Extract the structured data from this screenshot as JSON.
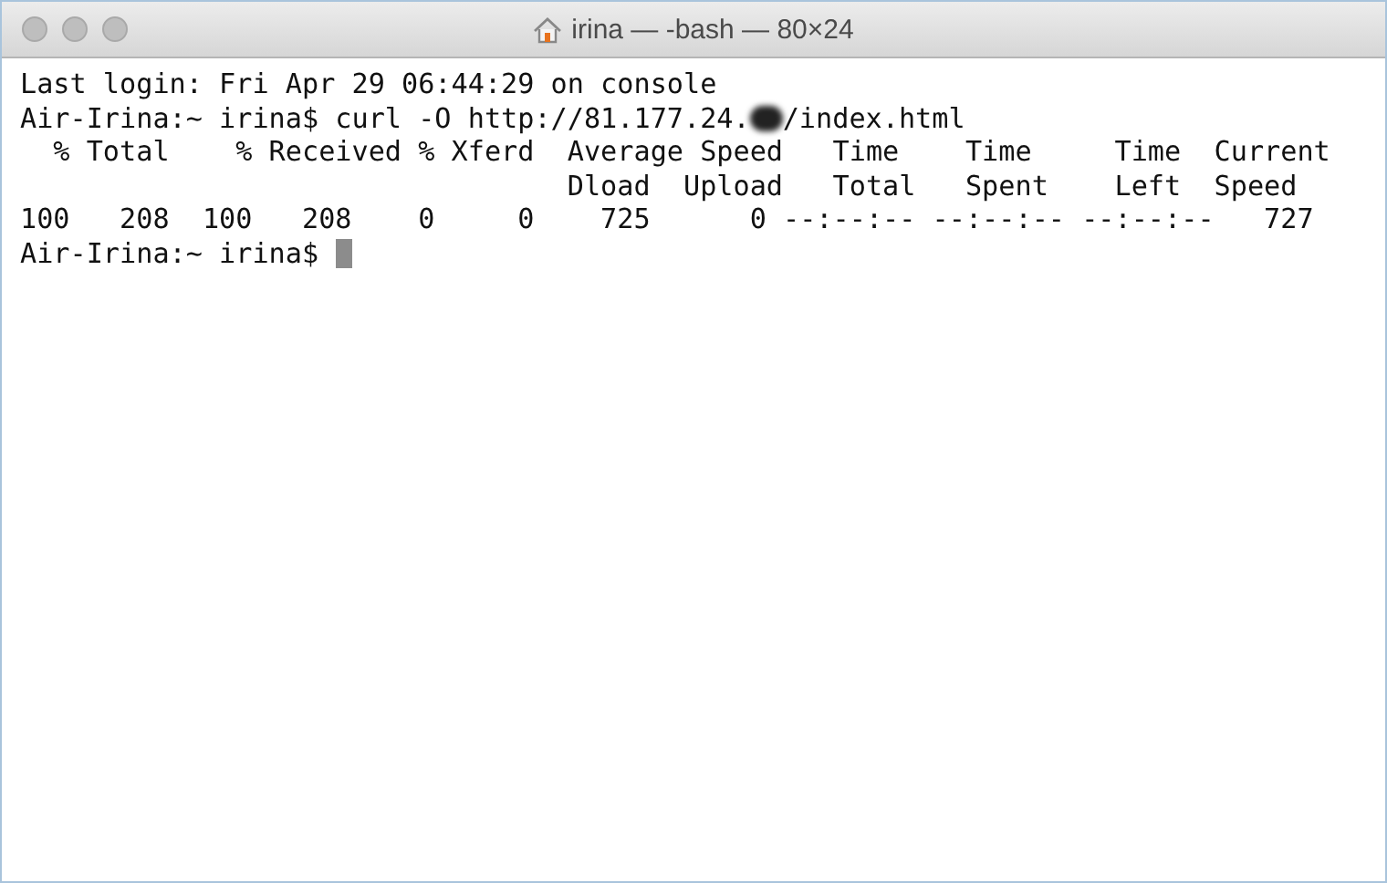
{
  "window": {
    "title": "irina — -bash — 80×24"
  },
  "terminal": {
    "lines": [
      {
        "kind": "text",
        "text": "Last login: Fri Apr 29 06:44:29 on console"
      },
      {
        "kind": "redacted",
        "before": "Air-Irina:~ irina$ curl -O http://81.177.24.",
        "after": "/index.html"
      },
      {
        "kind": "text",
        "text": "  % Total    % Received % Xferd  Average Speed   Time    Time     Time  Current"
      },
      {
        "kind": "text",
        "text": "                                 Dload  Upload   Total   Spent    Left  Speed"
      },
      {
        "kind": "text",
        "text": "100   208  100   208    0     0    725      0 --:--:-- --:--:-- --:--:--   727"
      },
      {
        "kind": "prompt",
        "text": "Air-Irina:~ irina$ "
      }
    ]
  }
}
